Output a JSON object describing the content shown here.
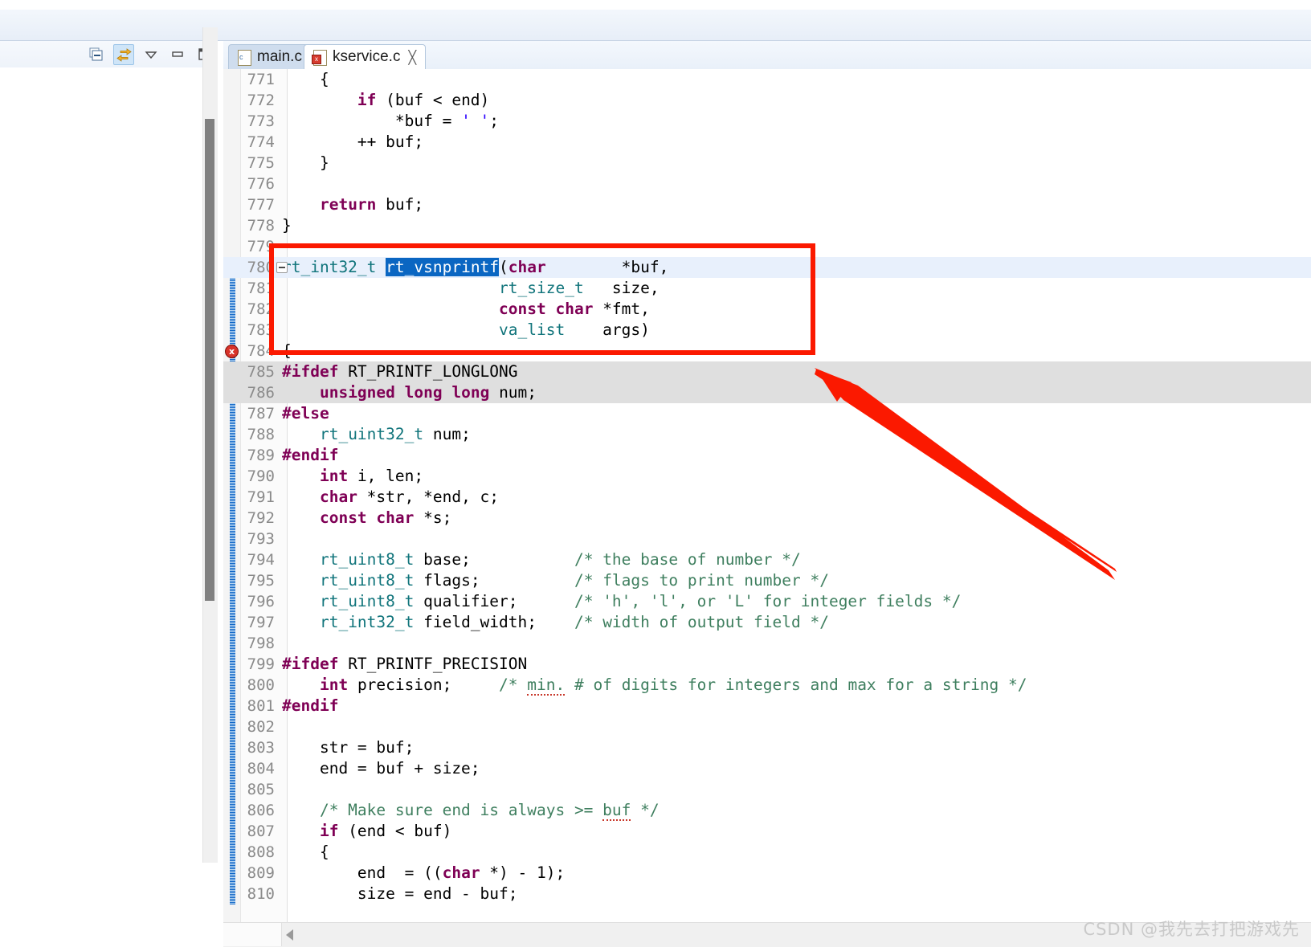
{
  "window": {
    "title_bar_visible": true
  },
  "left_panel": {
    "toolbar": {
      "buttons": [
        {
          "name": "collapse-all",
          "label": "Collapse All",
          "active": false
        },
        {
          "name": "link-with-editor",
          "label": "Link with Editor",
          "active": true
        },
        {
          "name": "view-menu",
          "label": "View Menu",
          "active": false
        },
        {
          "name": "minimize",
          "label": "Minimize",
          "active": false
        },
        {
          "name": "maximize",
          "label": "Maximize",
          "active": false
        }
      ]
    }
  },
  "editor": {
    "tabs": [
      {
        "label": "main.c",
        "active": false,
        "has_error": false,
        "closable": false
      },
      {
        "label": "kservice.c",
        "active": true,
        "has_error": true,
        "closable": true,
        "close_glyph": "╳"
      }
    ],
    "selection": "rt_vsnprintf",
    "current_line": 780,
    "error_line": 784,
    "folding_line": 780,
    "change_bar_from": 780,
    "change_bar_to": 810,
    "colors": {
      "keyword": "#7f0055",
      "type": "#10747b",
      "comment": "#3f7f5f",
      "string": "#2a00ff",
      "selection": "#0a66c2",
      "current_line": "#e8f0fc",
      "inactive_block": "#dfdfdf",
      "annotation": "#fb1900"
    },
    "lines": [
      {
        "n": "771",
        "segs": [
          {
            "t": "    {"
          }
        ]
      },
      {
        "n": "772",
        "segs": [
          {
            "t": "        "
          },
          {
            "t": "if",
            "c": "kw"
          },
          {
            "t": " (buf < end)"
          }
        ]
      },
      {
        "n": "773",
        "segs": [
          {
            "t": "            *buf = "
          },
          {
            "t": "' '",
            "c": "str"
          },
          {
            "t": ";"
          }
        ]
      },
      {
        "n": "774",
        "segs": [
          {
            "t": "        ++ buf;"
          }
        ]
      },
      {
        "n": "775",
        "segs": [
          {
            "t": "    }"
          }
        ]
      },
      {
        "n": "776",
        "segs": [
          {
            "t": ""
          }
        ]
      },
      {
        "n": "777",
        "segs": [
          {
            "t": "    "
          },
          {
            "t": "return",
            "c": "kw"
          },
          {
            "t": " buf;"
          }
        ]
      },
      {
        "n": "778",
        "segs": [
          {
            "t": "}"
          }
        ]
      },
      {
        "n": "779",
        "segs": [
          {
            "t": ""
          }
        ]
      },
      {
        "n": "780",
        "cur": true,
        "fold": true,
        "segs": [
          {
            "t": "rt_int32_t",
            "c": "typ"
          },
          {
            "t": " "
          },
          {
            "t": "rt_vsnprintf",
            "c": "sel"
          },
          {
            "t": "("
          },
          {
            "t": "char",
            "c": "kw"
          },
          {
            "t": "        *buf,"
          }
        ]
      },
      {
        "n": "781",
        "segs": [
          {
            "t": "                       "
          },
          {
            "t": "rt_size_t",
            "c": "typ"
          },
          {
            "t": "   size,"
          }
        ]
      },
      {
        "n": "782",
        "segs": [
          {
            "t": "                       "
          },
          {
            "t": "const",
            "c": "kw"
          },
          {
            "t": " "
          },
          {
            "t": "char",
            "c": "kw"
          },
          {
            "t": " *fmt,"
          }
        ]
      },
      {
        "n": "783",
        "segs": [
          {
            "t": "                       "
          },
          {
            "t": "va_list",
            "c": "typ"
          },
          {
            "t": "    args)"
          }
        ]
      },
      {
        "n": "784",
        "err": true,
        "segs": [
          {
            "t": "{"
          }
        ]
      },
      {
        "n": "785",
        "inactive": true,
        "segs": [
          {
            "t": "#ifdef",
            "c": "pp"
          },
          {
            "t": " RT_PRINTF_LONGLONG"
          }
        ]
      },
      {
        "n": "786",
        "inactive": true,
        "segs": [
          {
            "t": "    "
          },
          {
            "t": "unsigned",
            "c": "kw"
          },
          {
            "t": " "
          },
          {
            "t": "long",
            "c": "kw"
          },
          {
            "t": " "
          },
          {
            "t": "long",
            "c": "kw"
          },
          {
            "t": " num;"
          }
        ]
      },
      {
        "n": "787",
        "segs": [
          {
            "t": "#else",
            "c": "pp"
          }
        ]
      },
      {
        "n": "788",
        "segs": [
          {
            "t": "    "
          },
          {
            "t": "rt_uint32_t",
            "c": "typ"
          },
          {
            "t": " num;"
          }
        ]
      },
      {
        "n": "789",
        "segs": [
          {
            "t": "#endif",
            "c": "pp"
          }
        ]
      },
      {
        "n": "790",
        "segs": [
          {
            "t": "    "
          },
          {
            "t": "int",
            "c": "kw"
          },
          {
            "t": " i, len;"
          }
        ]
      },
      {
        "n": "791",
        "segs": [
          {
            "t": "    "
          },
          {
            "t": "char",
            "c": "kw"
          },
          {
            "t": " *str, *end, c;"
          }
        ]
      },
      {
        "n": "792",
        "segs": [
          {
            "t": "    "
          },
          {
            "t": "const",
            "c": "kw"
          },
          {
            "t": " "
          },
          {
            "t": "char",
            "c": "kw"
          },
          {
            "t": " *s;"
          }
        ]
      },
      {
        "n": "793",
        "segs": [
          {
            "t": ""
          }
        ]
      },
      {
        "n": "794",
        "segs": [
          {
            "t": "    "
          },
          {
            "t": "rt_uint8_t",
            "c": "typ"
          },
          {
            "t": " base;           "
          },
          {
            "t": "/* the base of number */",
            "c": "cmt"
          }
        ]
      },
      {
        "n": "795",
        "segs": [
          {
            "t": "    "
          },
          {
            "t": "rt_uint8_t",
            "c": "typ"
          },
          {
            "t": " flags;          "
          },
          {
            "t": "/* flags to print number */",
            "c": "cmt"
          }
        ]
      },
      {
        "n": "796",
        "segs": [
          {
            "t": "    "
          },
          {
            "t": "rt_uint8_t",
            "c": "typ"
          },
          {
            "t": " qualifier;      "
          },
          {
            "t": "/* 'h', 'l', or 'L' for integer fields */",
            "c": "cmt"
          }
        ]
      },
      {
        "n": "797",
        "segs": [
          {
            "t": "    "
          },
          {
            "t": "rt_int32_t",
            "c": "typ"
          },
          {
            "t": " field_width;    "
          },
          {
            "t": "/* width of output field */",
            "c": "cmt"
          }
        ]
      },
      {
        "n": "798",
        "segs": [
          {
            "t": ""
          }
        ]
      },
      {
        "n": "799",
        "segs": [
          {
            "t": "#ifdef",
            "c": "pp"
          },
          {
            "t": " RT_PRINTF_PRECISION"
          }
        ]
      },
      {
        "n": "800",
        "segs": [
          {
            "t": "    "
          },
          {
            "t": "int",
            "c": "kw"
          },
          {
            "t": " precision;     "
          },
          {
            "t": "/* ",
            "c": "cmt"
          },
          {
            "t": "min.",
            "c": "cmt",
            "squig": true
          },
          {
            "t": " # of digits for integers and max for a string */",
            "c": "cmt"
          }
        ]
      },
      {
        "n": "801",
        "segs": [
          {
            "t": "#endif",
            "c": "pp"
          }
        ]
      },
      {
        "n": "802",
        "segs": [
          {
            "t": ""
          }
        ]
      },
      {
        "n": "803",
        "segs": [
          {
            "t": "    str = buf;"
          }
        ]
      },
      {
        "n": "804",
        "segs": [
          {
            "t": "    end = buf + size;"
          }
        ]
      },
      {
        "n": "805",
        "segs": [
          {
            "t": ""
          }
        ]
      },
      {
        "n": "806",
        "segs": [
          {
            "t": "    /* Make sure end is always >= ",
            "c": "cmt"
          },
          {
            "t": "buf",
            "c": "cmt",
            "squig": true
          },
          {
            "t": " */",
            "c": "cmt"
          }
        ]
      },
      {
        "n": "807",
        "segs": [
          {
            "t": "    "
          },
          {
            "t": "if",
            "c": "kw"
          },
          {
            "t": " (end < buf)"
          }
        ]
      },
      {
        "n": "808",
        "segs": [
          {
            "t": "    {"
          }
        ]
      },
      {
        "n": "809",
        "segs": [
          {
            "t": "        end  = (("
          },
          {
            "t": "char",
            "c": "kw"
          },
          {
            "t": " *) - 1);"
          }
        ]
      },
      {
        "n": "810",
        "segs": [
          {
            "t": "        size = end - buf;"
          }
        ]
      }
    ]
  },
  "annotations": {
    "highlight_box": {
      "label": "function signature highlight",
      "color": "#fb1900"
    },
    "arrow": {
      "label": "pointer arrow to function signature",
      "color": "#fb1900"
    }
  },
  "watermark": {
    "text": "CSDN @我先去打把游戏先"
  }
}
